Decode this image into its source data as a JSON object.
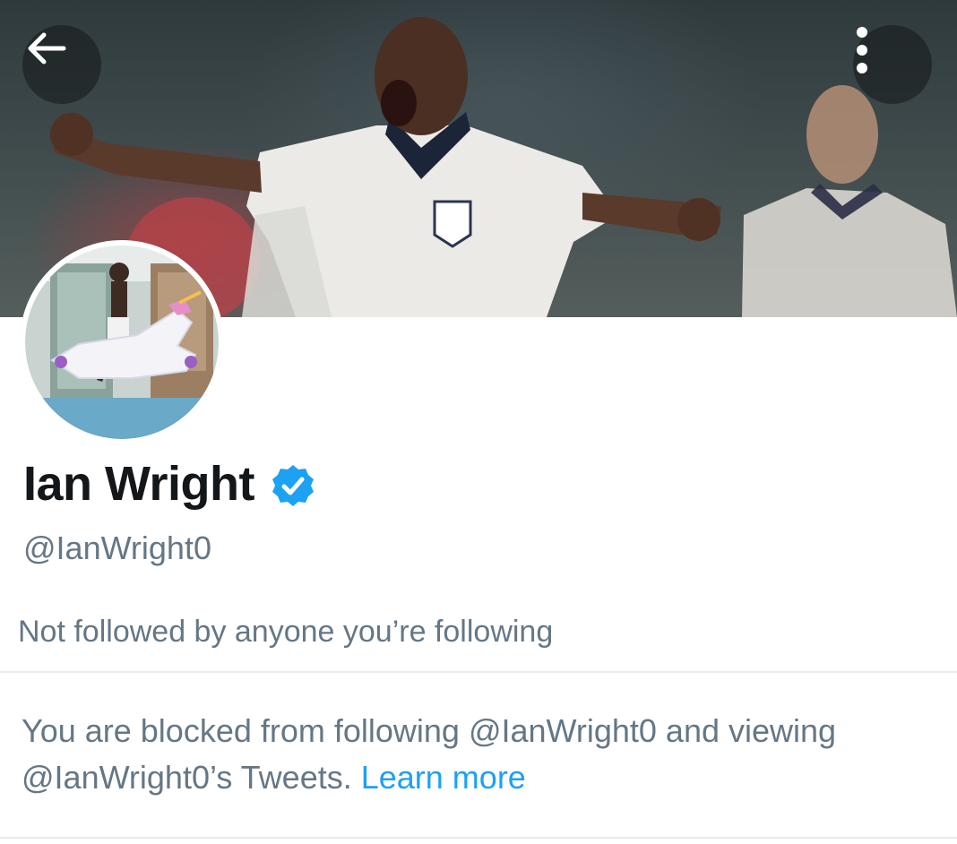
{
  "header": {
    "back_icon": "arrow-left-icon",
    "more_icon": "vertical-ellipsis-icon"
  },
  "profile": {
    "name": "Ian Wright",
    "verified_icon": "verified-badge-icon",
    "handle": "@IanWright0",
    "followers_note": "Not followed by anyone you’re following"
  },
  "blocked_notice": {
    "text": "You are blocked from following @IanWright0 and viewing @IanWright0’s Tweets.",
    "link_label": "Learn more"
  },
  "colors": {
    "accent": "#1da1f2",
    "secondary_text": "#657786",
    "primary_text": "#14171a",
    "divider": "#e6ecf0"
  }
}
